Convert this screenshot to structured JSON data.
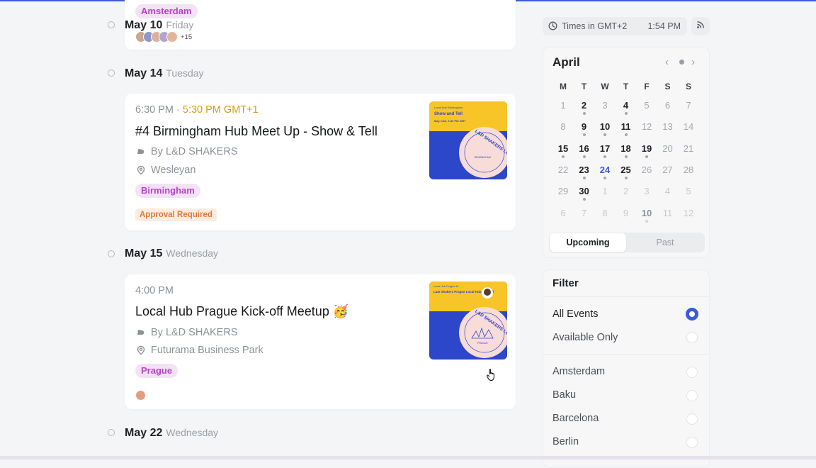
{
  "timezone": {
    "label": "Times in GMT+2",
    "clock": "1:54 PM"
  },
  "icons": {
    "clock": "clock-icon",
    "rss": "rss-icon",
    "host": "host-icon",
    "location": "location-pin-icon",
    "prev": "chevron-left-icon",
    "next": "chevron-right-icon",
    "today": "today-dot-icon"
  },
  "colors": {
    "accent": "#3b5bdb",
    "tag_bg": "#f3e2f5",
    "tag_text": "#b546c4",
    "alt_time": "#d99a14",
    "approval": "#e27a3a"
  },
  "events_top": {
    "tag": "Amsterdam",
    "date": "May 10",
    "dow": "Friday",
    "more": "+15"
  },
  "days": [
    {
      "date": "May 14",
      "dow": "Tuesday",
      "event": {
        "time": "6:30 PM · ",
        "time_alt": "5:30 PM GMT+1",
        "title": "#4 Birmingham Hub Meet Up - Show & Tell",
        "host": "By L&D SHAKERS",
        "location": "Wesleyan",
        "tag": "Birmingham",
        "badge": "Approval Required",
        "thumb": {
          "top": "Local Hub Birmingham",
          "head": "Show and Tell",
          "sub": "May 14th, 6:30 PM GMT",
          "ring": "L&D SHAKERS LOCAL HUB",
          "center": "BIRMINGHAM"
        }
      }
    },
    {
      "date": "May 15",
      "dow": "Wednesday",
      "event": {
        "time": "4:00 PM",
        "title": "Local Hub Prague Kick-off Meetup 🥳",
        "host": "By L&D SHAKERS",
        "location": "Futurama Business Park",
        "tag": "Prague",
        "thumb": {
          "top": "Local Hub Prague #1",
          "head": "L&D Shakers Prague Local Hub Kick-off",
          "ring": "L&D SHAKERS LOCAL HUB",
          "center": "PRAGUE"
        }
      }
    },
    {
      "date": "May 22",
      "dow": "Wednesday"
    }
  ],
  "calendar": {
    "month": "April",
    "weekdays": [
      "M",
      "T",
      "W",
      "T",
      "F",
      "S",
      "S"
    ],
    "weeks": [
      [
        [
          "1",
          ""
        ],
        [
          "2",
          "ev"
        ],
        [
          "3",
          ""
        ],
        [
          "4",
          "ev"
        ],
        [
          "5",
          ""
        ],
        [
          "6",
          ""
        ],
        [
          "7",
          ""
        ]
      ],
      [
        [
          "8",
          ""
        ],
        [
          "9",
          "ev"
        ],
        [
          "10",
          "ev"
        ],
        [
          "11",
          "ev"
        ],
        [
          "12",
          ""
        ],
        [
          "13",
          ""
        ],
        [
          "14",
          ""
        ]
      ],
      [
        [
          "15",
          "ev"
        ],
        [
          "16",
          "ev"
        ],
        [
          "17",
          "ev"
        ],
        [
          "18",
          "ev"
        ],
        [
          "19",
          "ev"
        ],
        [
          "20",
          ""
        ],
        [
          "21",
          ""
        ]
      ],
      [
        [
          "22",
          ""
        ],
        [
          "23",
          "ev"
        ],
        [
          "24",
          "today"
        ],
        [
          "25",
          "ev"
        ],
        [
          "26",
          ""
        ],
        [
          "27",
          ""
        ],
        [
          "28",
          ""
        ]
      ],
      [
        [
          "29",
          ""
        ],
        [
          "30",
          "ev"
        ],
        [
          "1",
          "out"
        ],
        [
          "2",
          "out"
        ],
        [
          "3",
          "out"
        ],
        [
          "4",
          "out"
        ],
        [
          "5",
          "out"
        ]
      ],
      [
        [
          "6",
          "out"
        ],
        [
          "7",
          "out"
        ],
        [
          "8",
          "out"
        ],
        [
          "9",
          "out"
        ],
        [
          "10",
          "outev"
        ],
        [
          "11",
          "out"
        ],
        [
          "12",
          "out"
        ]
      ]
    ],
    "tabs": {
      "upcoming": "Upcoming",
      "past": "Past"
    }
  },
  "filter": {
    "title": "Filter",
    "options": [
      {
        "label": "All Events",
        "selected": true
      },
      {
        "label": "Available Only",
        "selected": false
      }
    ],
    "cities": [
      "Amsterdam",
      "Baku",
      "Barcelona",
      "Berlin"
    ]
  }
}
